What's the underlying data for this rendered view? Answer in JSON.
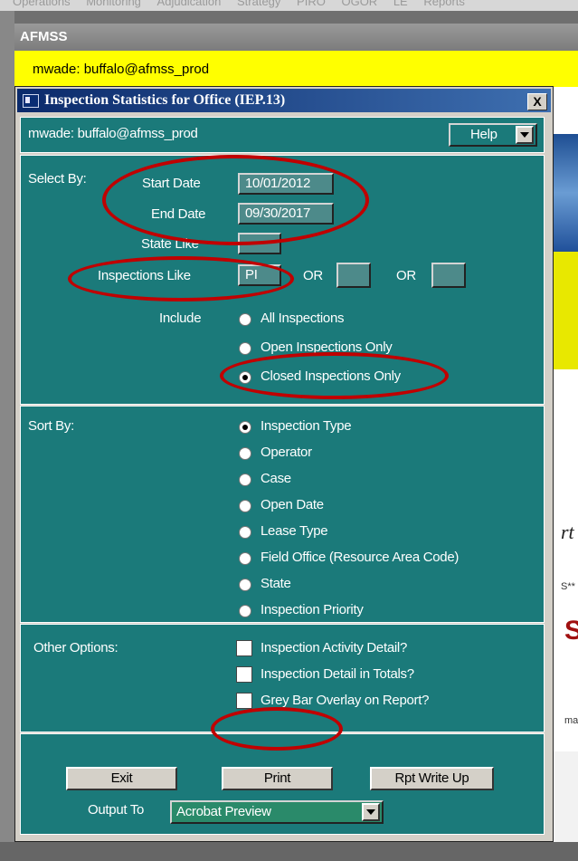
{
  "app": {
    "menu_items": [
      "Operations",
      "Monitoring",
      "Adjudication",
      "Strategy",
      "PIRO",
      "OGOR",
      "LE",
      "Reports"
    ],
    "window_title": "AFMSS",
    "user": "mwade: buffalo@afmss_prod"
  },
  "dialog": {
    "title": "Inspection Statistics for Office (IEP.13)",
    "close_label": "X",
    "user": "mwade: buffalo@afmss_prod",
    "help_label": "Help"
  },
  "select_by": {
    "section_label": "Select By:",
    "start_date_label": "Start Date",
    "start_date_value": "10/01/2012",
    "end_date_label": "End Date",
    "end_date_value": "09/30/2017",
    "state_like_label": "State Like",
    "state_like_value": "",
    "inspections_like_label": "Inspections Like",
    "inspections_like_value": "PI",
    "or_label": "OR",
    "or1_value": "",
    "or2_value": "",
    "include_label": "Include",
    "include_options": [
      "All Inspections",
      "Open Inspections Only",
      "Closed Inspections Only"
    ],
    "include_selected": "Closed Inspections Only"
  },
  "sort_by": {
    "section_label": "Sort By:",
    "options": [
      "Inspection Type",
      "Operator",
      "Case",
      "Open Date",
      "Lease Type",
      "Field Office (Resource Area Code)",
      "State",
      "Inspection Priority"
    ],
    "selected": "Inspection Type"
  },
  "other_options": {
    "section_label": "Other Options:",
    "checkboxes": [
      {
        "label": "Inspection Activity Detail?",
        "checked": false
      },
      {
        "label": "Inspection Detail in Totals?",
        "checked": false
      },
      {
        "label": "Grey Bar Overlay on Report?",
        "checked": false
      }
    ]
  },
  "actions": {
    "exit_label": "Exit",
    "print_label": "Print",
    "write_up_label": "Rpt Write Up",
    "output_to_label": "Output To",
    "output_to_value": "Acrobat Preview"
  },
  "background_fragments": {
    "rt": "rt",
    "s": "S",
    "sd": "S**",
    "ma": "ma"
  },
  "colors": {
    "panel": "#1b7a7a",
    "annotation": "#c00000",
    "title_bar": "#0b2a6b",
    "yellow_bar": "#ffff00"
  }
}
